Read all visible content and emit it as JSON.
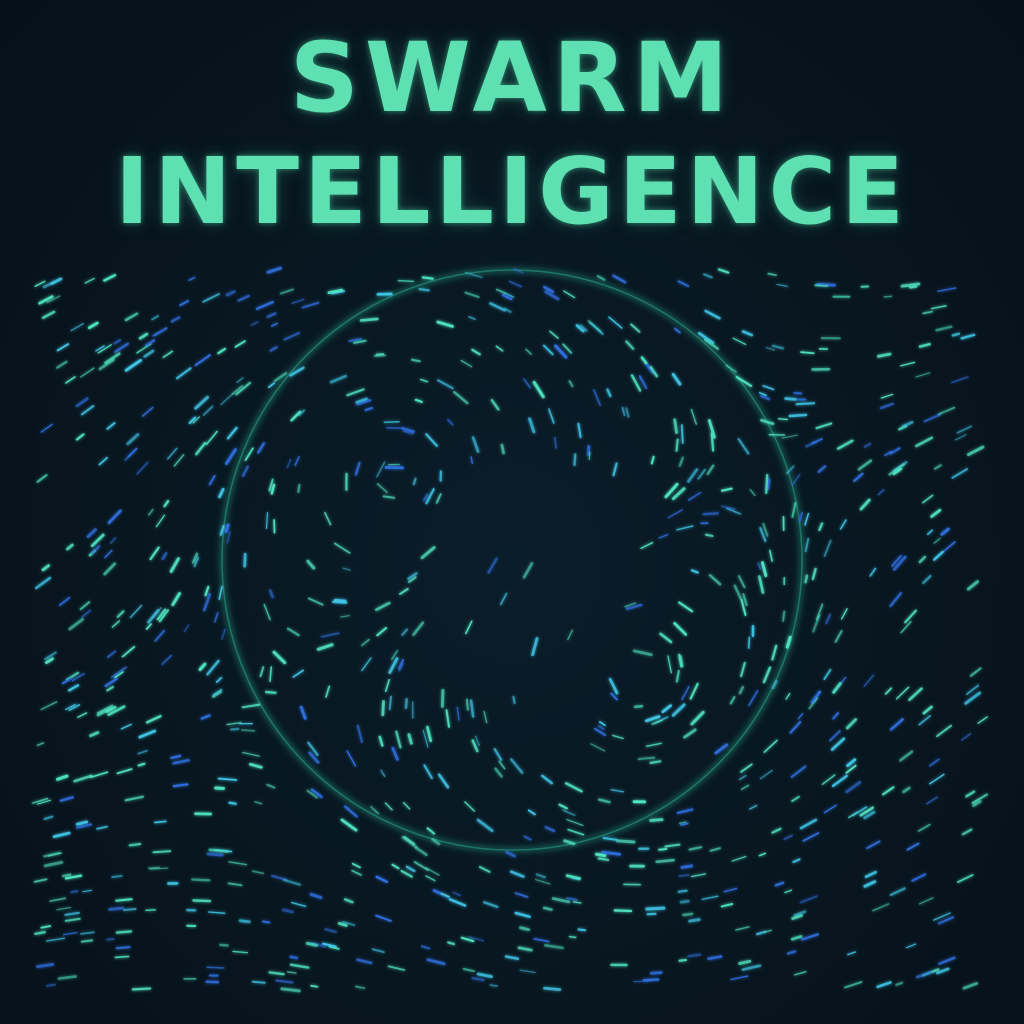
{
  "poster": {
    "title_line_1": "SWARM",
    "title_line_2": "INTELLIGENCE"
  },
  "colors": {
    "background": "#07131d",
    "title": "#5fe0b2",
    "particle_teal": "#4fe3c1",
    "particle_cyan": "#3fc6e8",
    "particle_blue": "#2f6fe0",
    "ring": "#2fbf9a"
  },
  "artwork": {
    "subject": "particle-swarm-vortex",
    "ring_icon": "glowing-ring"
  }
}
